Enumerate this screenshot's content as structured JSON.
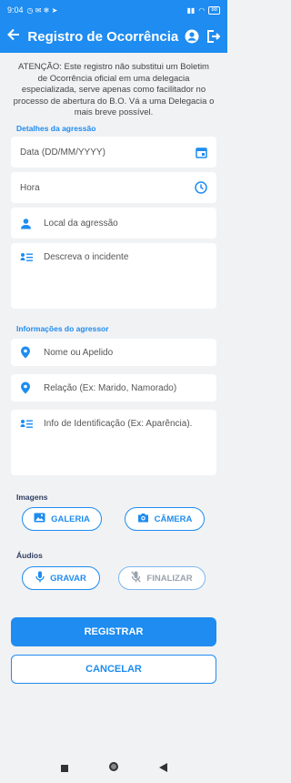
{
  "status_bar": {
    "time": "9:04",
    "battery": "88"
  },
  "app_bar": {
    "title": "Registro de Ocorrência"
  },
  "notice": "ATENÇÃO: Este registro não substitui um Boletim de Ocorrência oficial em uma delegacia especializada, serve apenas como facilitador no processo de abertura do B.O. Vá a uma Delegacia o mais breve possível.",
  "aggression_section": {
    "label": "Detalhes da agressão",
    "date_placeholder": "Data (DD/MM/YYYY)",
    "time_placeholder": "Hora",
    "location_placeholder": "Local da agressão",
    "description_placeholder": "Descreva o incidente"
  },
  "aggressor_section": {
    "label": "Informações do agressor",
    "name_placeholder": "Nome ou Apelido",
    "relation_placeholder": "Relação (Ex: Marido, Namorado)",
    "identification_placeholder": "Info de Identificação (Ex: Aparência)."
  },
  "images_section": {
    "label": "Imagens",
    "gallery_label": "GALERIA",
    "camera_label": "CÂMERA"
  },
  "audio_section": {
    "label": "Áudios",
    "record_label": "GRAVAR",
    "stop_label": "FINALIZAR"
  },
  "actions": {
    "register_label": "REGISTRAR",
    "cancel_label": "CANCELAR"
  },
  "colors": {
    "primary": "#1e8cf0",
    "background": "#f1f2f4",
    "section_dark": "#2f3e60"
  }
}
